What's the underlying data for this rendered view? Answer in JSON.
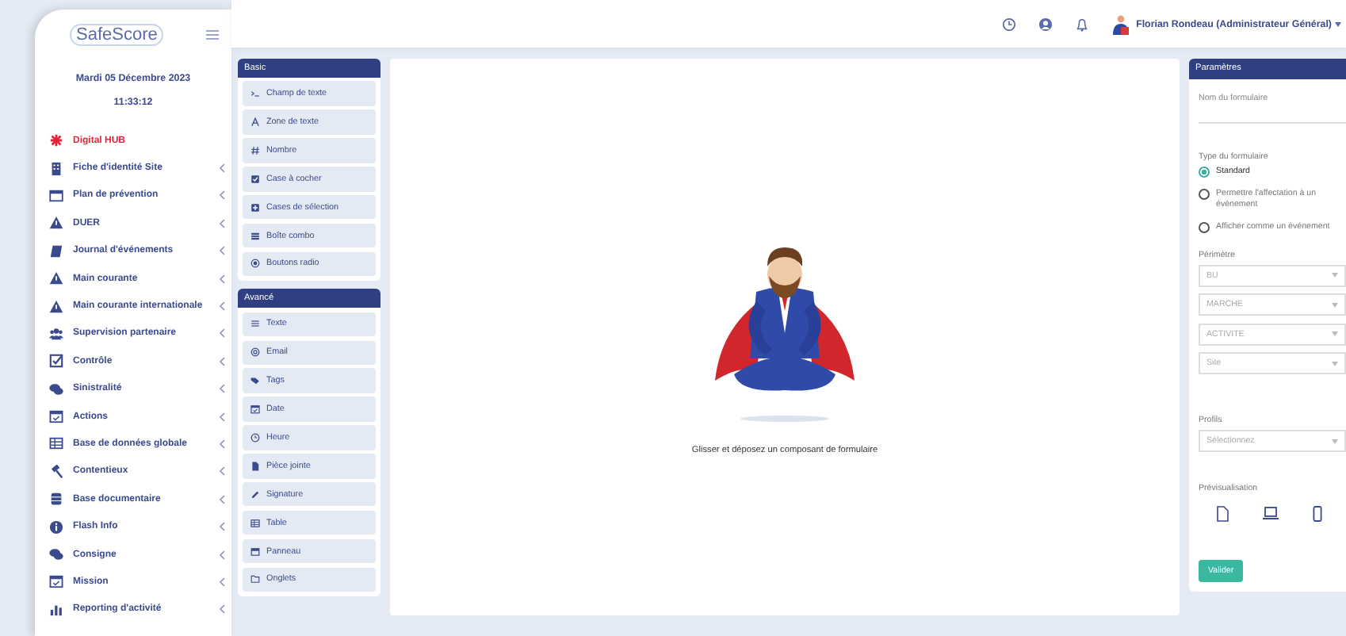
{
  "sidebar": {
    "logo": "SafeScore",
    "date": "Mardi 05 Décembre 2023",
    "time": "11:33:12",
    "items": [
      {
        "label": "Digital HUB",
        "selected": true,
        "has_submenu": false
      },
      {
        "label": "Fiche d'identité Site",
        "selected": false,
        "has_submenu": true
      },
      {
        "label": "Plan de prévention",
        "selected": false,
        "has_submenu": true
      },
      {
        "label": "DUER",
        "selected": false,
        "has_submenu": true
      },
      {
        "label": "Journal d'événements",
        "selected": false,
        "has_submenu": true
      },
      {
        "label": "Main courante",
        "selected": false,
        "has_submenu": true
      },
      {
        "label": "Main courante internationale",
        "selected": false,
        "has_submenu": true
      },
      {
        "label": "Supervision partenaire",
        "selected": false,
        "has_submenu": true
      },
      {
        "label": "Contrôle",
        "selected": false,
        "has_submenu": true
      },
      {
        "label": "Sinistralité",
        "selected": false,
        "has_submenu": true
      },
      {
        "label": "Actions",
        "selected": false,
        "has_submenu": true
      },
      {
        "label": "Base de données globale",
        "selected": false,
        "has_submenu": true
      },
      {
        "label": "Contentieux",
        "selected": false,
        "has_submenu": true
      },
      {
        "label": "Base documentaire",
        "selected": false,
        "has_submenu": true
      },
      {
        "label": "Flash Info",
        "selected": false,
        "has_submenu": true
      },
      {
        "label": "Consigne",
        "selected": false,
        "has_submenu": true
      },
      {
        "label": "Mission",
        "selected": false,
        "has_submenu": true
      },
      {
        "label": "Reporting d'activité",
        "selected": false,
        "has_submenu": true
      }
    ]
  },
  "topbar": {
    "user": "Florian Rondeau (Administrateur Général)"
  },
  "toolbox": [
    {
      "title": "Basic",
      "items": [
        "Champ de texte",
        "Zone de texte",
        "Nombre",
        "Case à cocher",
        "Cases de sélection",
        "Boîte combo",
        "Boutons radio"
      ]
    },
    {
      "title": "Avancé",
      "items": [
        "Texte",
        "Email",
        "Tags",
        "Date",
        "Heure",
        "Pièce jointe",
        "Signature",
        "Table",
        "Panneau",
        "Onglets"
      ]
    }
  ],
  "canvas": {
    "hint": "Glisser et déposez un composant de formulaire"
  },
  "params": {
    "title": "Paramètres",
    "name_field": {
      "placeholder": "Nom du formulaire"
    },
    "type_label": "Type du formulaire",
    "types": [
      {
        "label": "Standard",
        "selected": true
      },
      {
        "label": "Permettre l'affectation à un événement",
        "selected": false
      },
      {
        "label": "Afficher comme un événement",
        "selected": false
      }
    ],
    "perimeter_label": "Périmètre",
    "perimeter_selects": [
      {
        "placeholder": "BU"
      },
      {
        "placeholder": "MARCHE"
      },
      {
        "placeholder": "ACTIVITE"
      },
      {
        "placeholder": "Site"
      }
    ],
    "profiles_label": "Profils",
    "profiles_select": {
      "placeholder": "Sélectionnez"
    },
    "preview_label": "Prévisualisation",
    "submit": "Valider"
  }
}
